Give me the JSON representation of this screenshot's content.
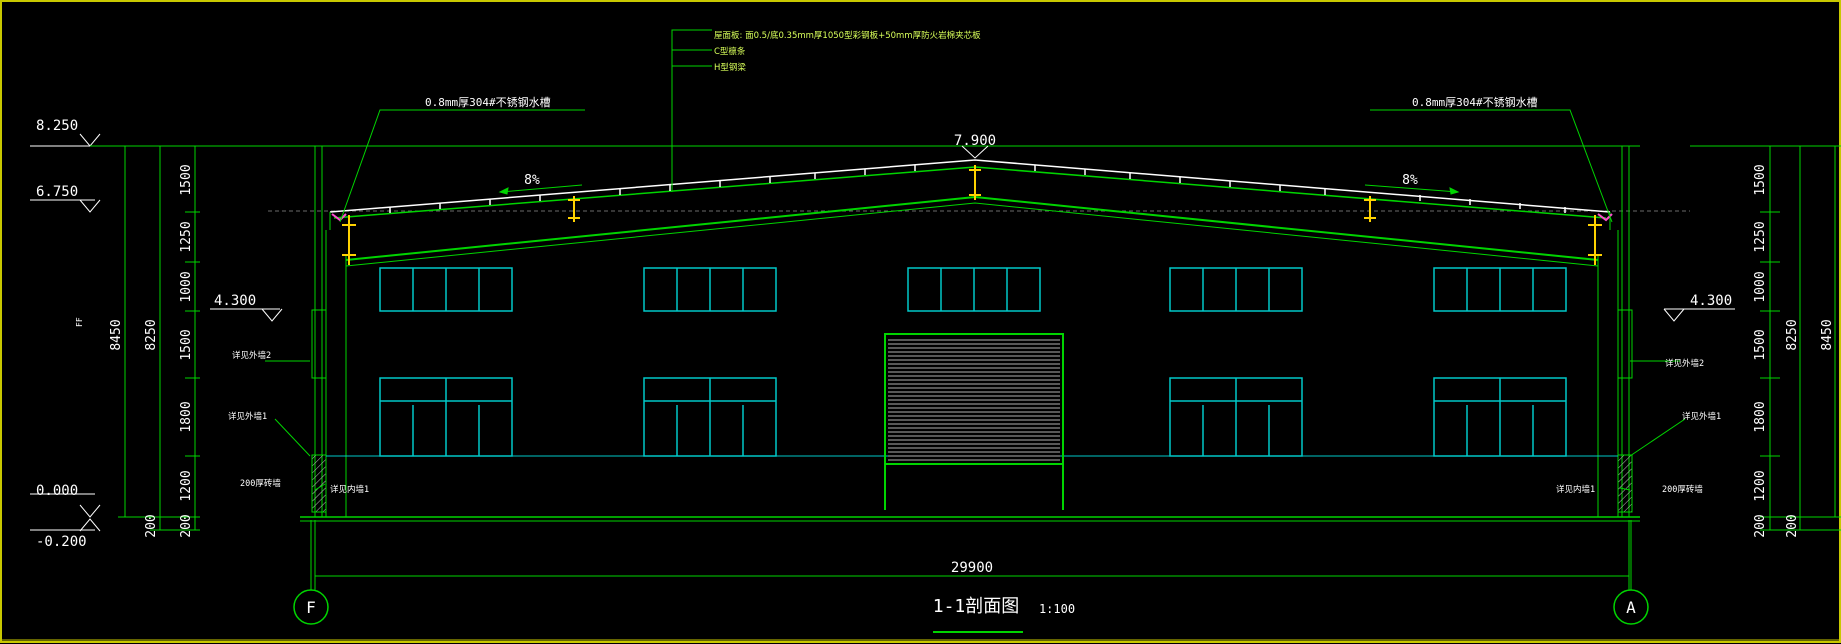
{
  "drawing": {
    "title": "1-1剖面图",
    "scale": "1:100",
    "overall_dimension": "29900",
    "ridge_level": "7.900",
    "slope_left": "8%",
    "slope_right": "8%",
    "grid_left": "F",
    "grid_right": "A",
    "roof_callout": {
      "line1": "屋面板: 面0.5/底0.35mm厚1050型彩钢板+50mm厚防火岩棉夹芯板",
      "line2": "C型檩条",
      "line3": "H型钢梁"
    },
    "gutter_left": "0.8mm厚304#不锈钢水槽",
    "gutter_right": "0.8mm厚304#不锈钢水槽",
    "levels_left": [
      "8.250",
      "6.750",
      "4.300",
      "0.000",
      "-0.200"
    ],
    "level_right": "4.300",
    "vertical_dims": [
      "1500",
      "1250",
      "1000",
      "1500",
      "1800",
      "1200",
      "200"
    ],
    "total_height_inner": "8250",
    "total_height_outer": "8450",
    "notes_left": {
      "wall2": "详见外墙2",
      "wall1": "详见外墙1",
      "brick": "200厚砖墙",
      "inner1": "详见内墙1"
    },
    "notes_right": {
      "wall2": "详见外墙2",
      "wall1": "详见外墙1",
      "brick": "200厚砖墙",
      "inner1": "详见内墙1"
    },
    "stray_left": "FF"
  },
  "colors": {
    "background": "#000000",
    "structure": "#00d400",
    "window": "#00c8c8",
    "text": "#ffffff",
    "steel": "#ffd200",
    "callout": "#d8ff5a"
  }
}
